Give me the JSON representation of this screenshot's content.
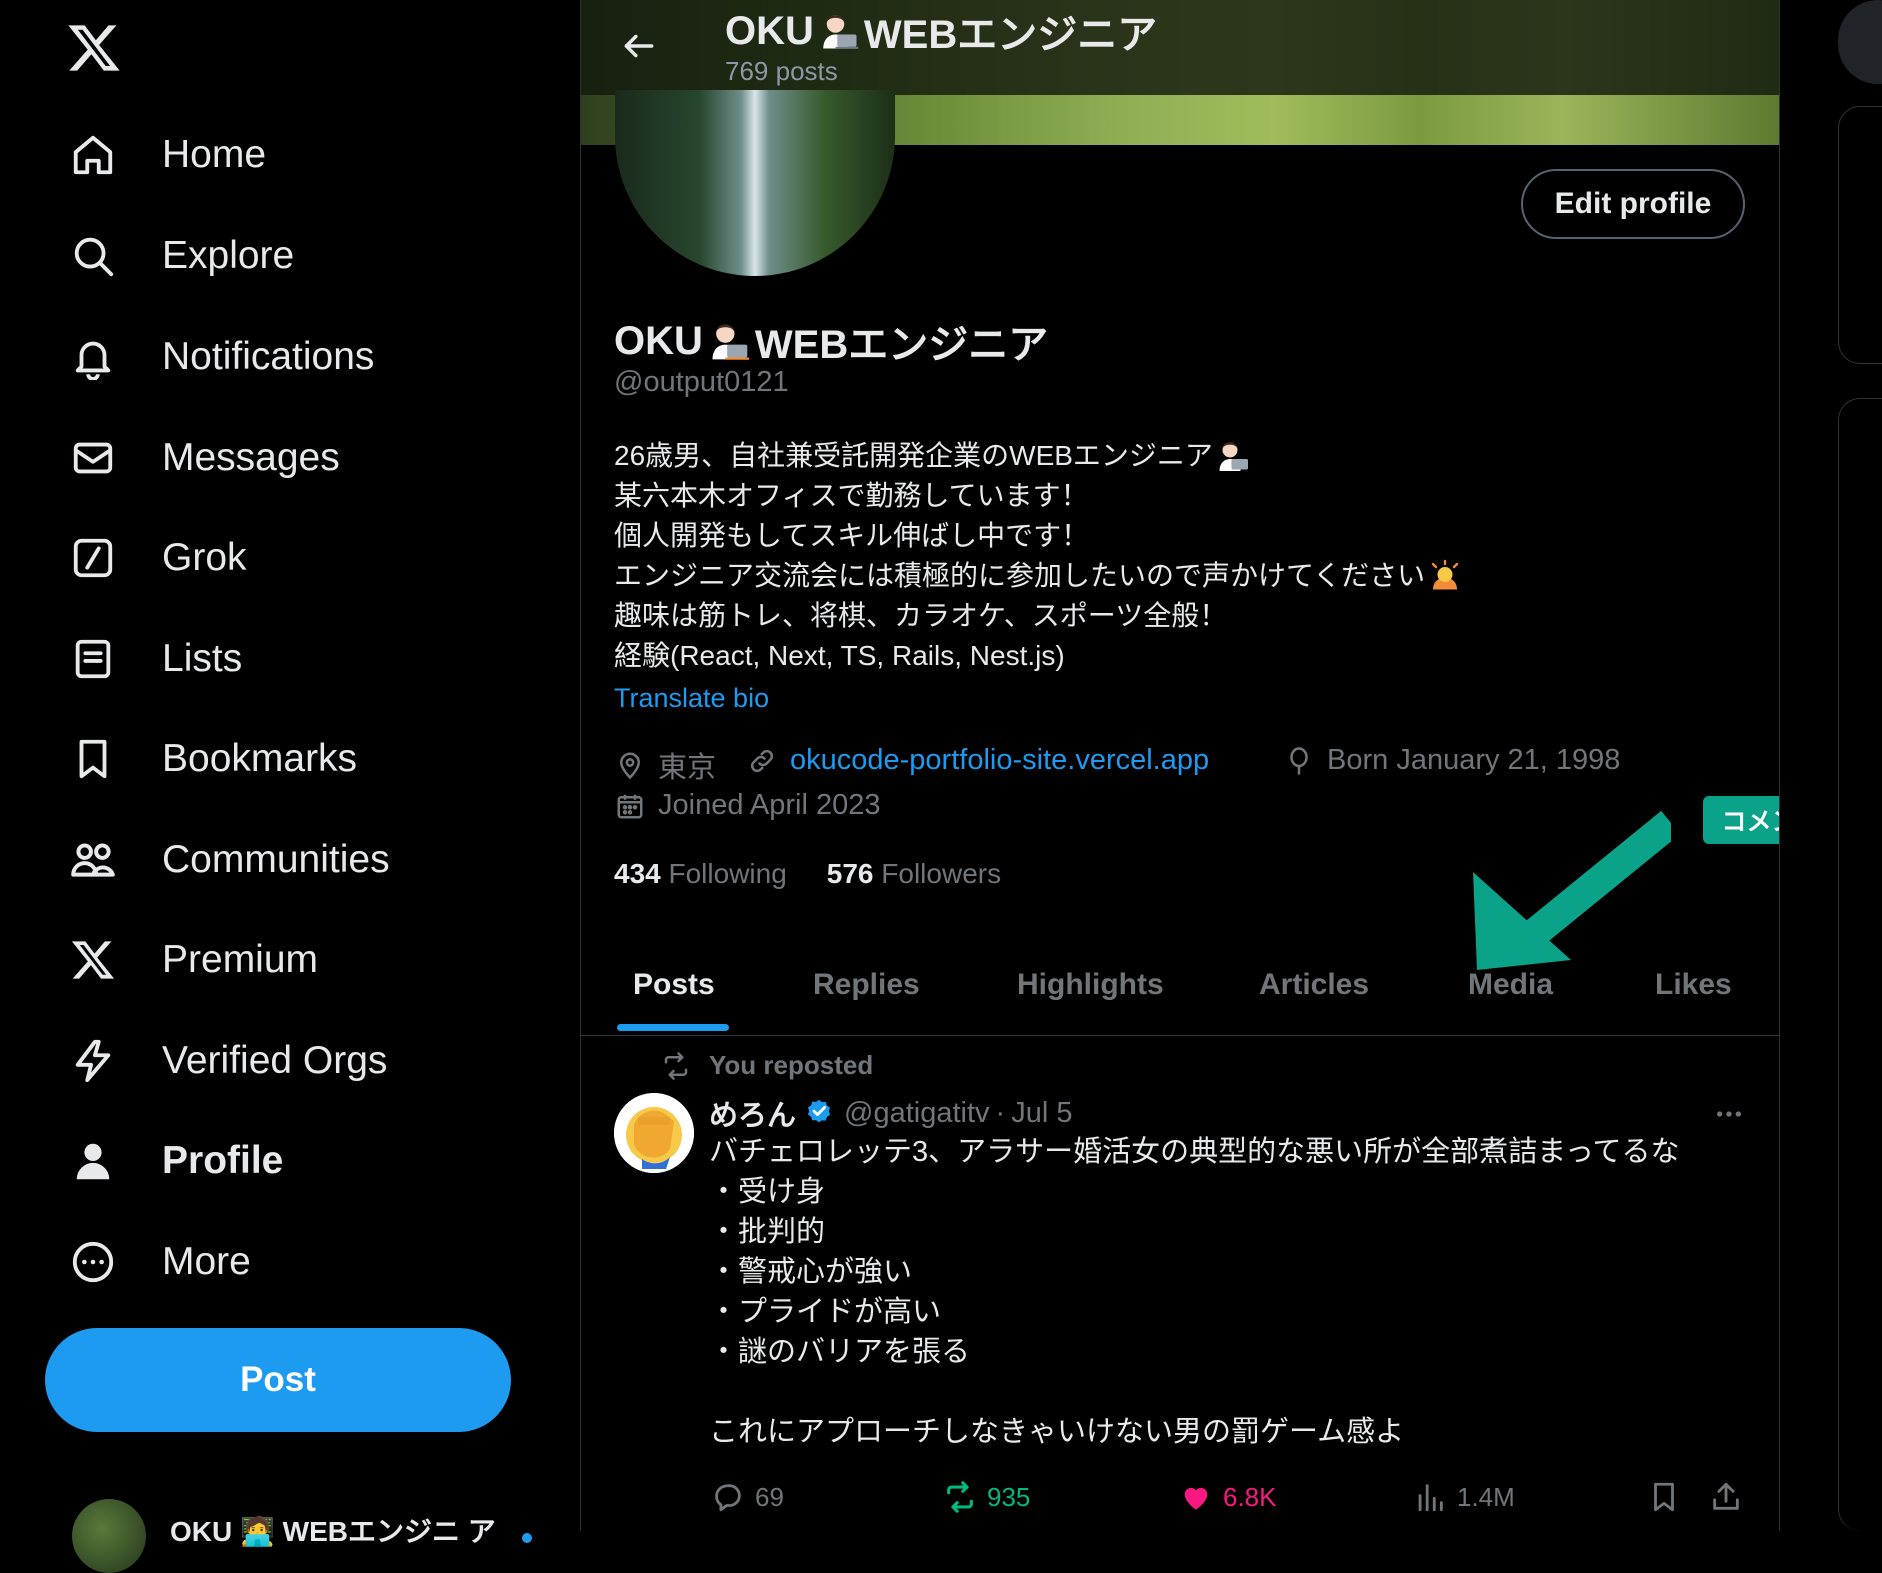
{
  "sidebar": {
    "items": [
      {
        "label": "Home",
        "icon": "home-icon"
      },
      {
        "label": "Explore",
        "icon": "search-icon"
      },
      {
        "label": "Notifications",
        "icon": "bell-icon"
      },
      {
        "label": "Messages",
        "icon": "envelope-icon"
      },
      {
        "label": "Grok",
        "icon": "grok-icon"
      },
      {
        "label": "Lists",
        "icon": "list-icon"
      },
      {
        "label": "Bookmarks",
        "icon": "bookmark-icon"
      },
      {
        "label": "Communities",
        "icon": "people-icon"
      },
      {
        "label": "Premium",
        "icon": "x-logo-icon"
      },
      {
        "label": "Verified Orgs",
        "icon": "lightning-icon"
      },
      {
        "label": "Profile",
        "icon": "person-icon"
      },
      {
        "label": "More",
        "icon": "more-circle-icon"
      }
    ],
    "active": "Profile",
    "post_label": "Post",
    "account_name": "OKU 🧑‍💻 WEBエンジニ ア"
  },
  "header": {
    "name_prefix": "OKU",
    "name_suffix": "WEBエンジニア",
    "post_count": "769 posts"
  },
  "profile": {
    "edit_label": "Edit profile",
    "name_prefix": "OKU",
    "name_suffix": "WEBエンジニア",
    "handle": "@output0121",
    "bio": [
      "26歳男、自社兼受託開発企業のWEBエンジニア",
      "某六本木オフィスで勤務しています！",
      "個人開発もしてスキル伸ばし中です！",
      "エンジニア交流会には積極的に参加したいので声かけてください",
      "趣味は筋トレ、将棋、カラオケ、スポーツ全般！",
      "経験(React, Next, TS, Rails, Nest.js)"
    ],
    "translate_label": "Translate bio",
    "location": "東京",
    "website": "okucode-portfolio-site.vercel.app",
    "birthday": "Born January 21, 1998",
    "joined": "Joined April 2023",
    "following_count": "434",
    "following_label": "Following",
    "followers_count": "576",
    "followers_label": "Followers"
  },
  "tabs": [
    "Posts",
    "Replies",
    "Highlights",
    "Articles",
    "Media",
    "Likes"
  ],
  "active_tab": "Posts",
  "annotation": {
    "label": "コメント一覧と表示",
    "color": "#0aa38a"
  },
  "tweet": {
    "repost_label": "You reposted",
    "author": "めろん",
    "handle": "@gatigatitv",
    "date": "Jul 5",
    "separator": "·",
    "body": "バチェロレッテ3、アラサー婚活女の典型的な悪い所が全部煮詰まってるな\n・受け身\n・批判的\n・警戒心が強い\n・プライドが高い\n・謎のバリアを張る\n\nこれにアプローチしなきゃいけない男の罰ゲーム感よ",
    "replies": "69",
    "reposts": "935",
    "likes": "6.8K",
    "views": "1.4M"
  },
  "colors": {
    "accent": "#1d9bf0",
    "repost_green": "#00ba7c",
    "like_pink": "#f91880",
    "muted": "#71767b",
    "border": "#2f3336"
  }
}
